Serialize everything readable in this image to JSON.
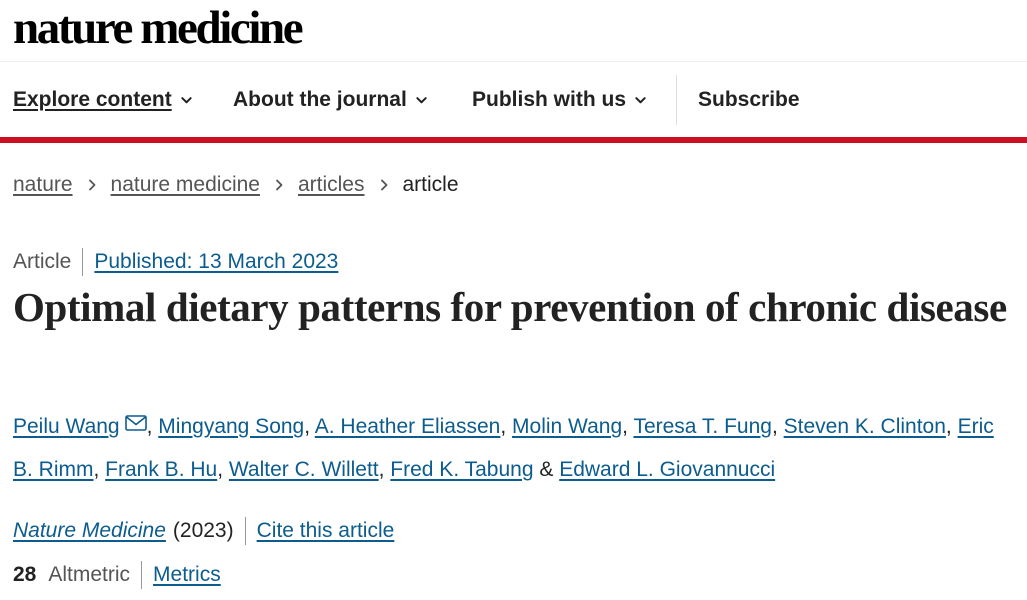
{
  "site": {
    "logo_text": "nature medicine"
  },
  "nav": {
    "items": [
      {
        "label": "Explore content"
      },
      {
        "label": "About the journal"
      },
      {
        "label": "Publish with us"
      }
    ],
    "subscribe_label": "Subscribe"
  },
  "colors": {
    "brand_red": "#cc1021",
    "link_blue": "#0c5c8f",
    "text": "#222222"
  },
  "breadcrumb": {
    "items": [
      {
        "label": "nature"
      },
      {
        "label": "nature medicine"
      },
      {
        "label": "articles"
      }
    ],
    "current": "article"
  },
  "article": {
    "type": "Article",
    "published": "Published: 13 March 2023",
    "title": "Optimal dietary patterns for prevention of chronic disease",
    "authors": [
      "Peilu Wang",
      "Mingyang Song",
      "A. Heather Eliassen",
      "Molin Wang",
      "Teresa T. Fung",
      "Steven K. Clinton",
      "Eric B. Rimm",
      "Frank B. Hu",
      "Walter C. Willett",
      "Fred K. Tabung",
      "Edward L. Giovannucci"
    ],
    "author_separator": ", ",
    "author_final_joiner": " & ",
    "corresponding_icon": "mail-icon",
    "journal": "Nature Medicine",
    "year": "(2023)",
    "cite_label": "Cite this article",
    "altmetric_count": "28",
    "altmetric_label": "Altmetric",
    "metrics_label": "Metrics"
  }
}
